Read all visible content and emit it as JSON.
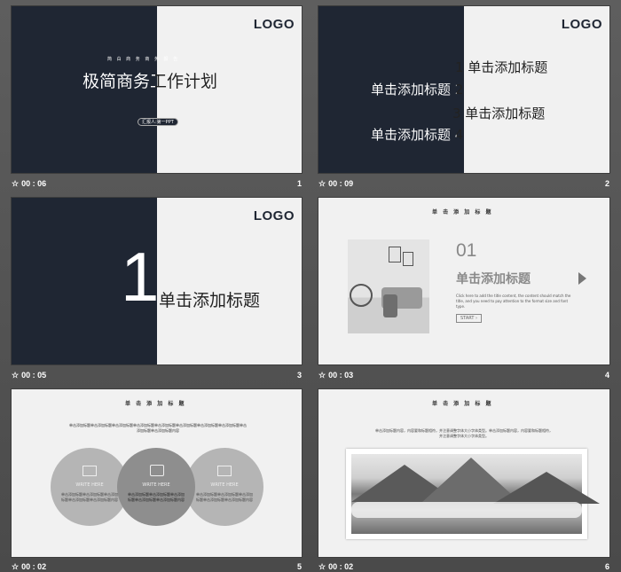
{
  "slides": [
    {
      "time": "00 : 06",
      "number": "1",
      "logo": "LOGO",
      "kicker": "简 白 商 务 商 务 报 告",
      "title": "极简商务工作计划",
      "pill": "汇报人:第一PPT"
    },
    {
      "time": "00 : 09",
      "number": "2",
      "logo": "LOGO",
      "items": [
        "1 单击添加标题",
        "单击添加标题 2",
        "3 单击添加标题",
        "单击添加标题 4"
      ]
    },
    {
      "time": "00 : 05",
      "number": "3",
      "logo": "LOGO",
      "big_number": "1",
      "title": "单击添加标题"
    },
    {
      "time": "00 : 03",
      "number": "4",
      "heading": "单 击 添 加 标 题",
      "number_label": "01",
      "title": "单击添加标题",
      "desc": "Click here to add the title content, the content should match the title, and you need to pay attention to the format size and font type.",
      "button": "START"
    },
    {
      "time": "00 : 02",
      "number": "5",
      "heading": "单 击 添 加 标 题",
      "intro": "单击添加标题单击添加标题单击添加标题单击添加标题单击添加标题单击添加标题单击添加标题单击添加标题单击添加标题单击添加标题内容",
      "circles": [
        {
          "label": "WRITE HERE",
          "icon": "mail-icon",
          "text": "单击添加标题单击添加标题单击添加标题单击添加标题单击添加标题内容"
        },
        {
          "label": "WRITE HERE",
          "icon": "camera-icon",
          "text": "单击添加标题单击添加标题单击添加标题单击添加标题单击添加标题内容"
        },
        {
          "label": "WRITE HERE",
          "icon": "image-icon",
          "text": "单击添加标题单击添加标题单击添加标题单击添加标题单击添加标题内容"
        }
      ]
    },
    {
      "time": "00 : 02",
      "number": "6",
      "heading": "单 击 添 加 标 题",
      "text": "单击添加标题内容，内容要和标题相符，并注意调整字体大小字体类型。单击添加标题内容，内容要和标题相符，并注意调整字体大小字体类型。"
    }
  ]
}
